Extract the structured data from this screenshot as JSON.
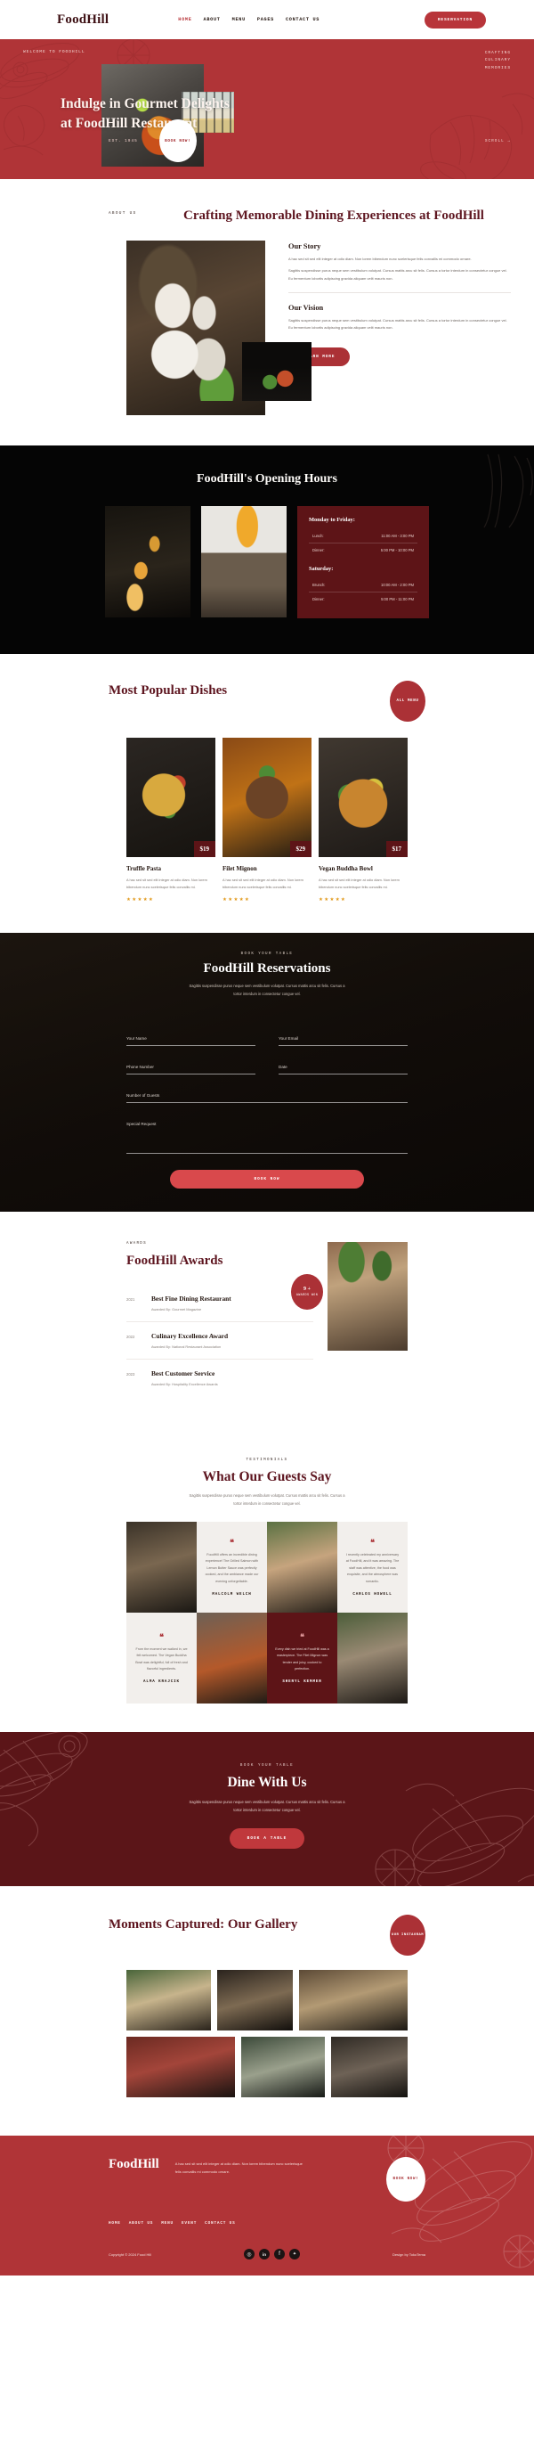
{
  "header": {
    "logo": "FoodHill",
    "nav": [
      {
        "label": "HOME",
        "active": true
      },
      {
        "label": "ABOUT",
        "active": false
      },
      {
        "label": "MENU",
        "active": false
      },
      {
        "label": "PAGES",
        "active": false
      },
      {
        "label": "CONTACT US",
        "active": false
      }
    ],
    "cta_label": "RESERVATION"
  },
  "hero": {
    "eyebrow_left": "WELCOME TO FOODHILL",
    "eyebrow_right": "CRAFTING CULINARY MEMORIES",
    "title": "Indulge in Gourmet Delights at FoodHill Restaurant",
    "est": "EST. 1945",
    "book_label": "BOOK NOW!",
    "scroll_label": "SCROLL →"
  },
  "about": {
    "eyebrow": "ABOUT US",
    "title": "Crafting Memorable Dining Experiences at FoodHill",
    "story_title": "Our Story",
    "story_p1": "A hac sed sit sed elit integer at odio diam. Non lorem bibendum nunc scelerisque felis convallis mi commodo ornare.",
    "story_p2": "Sagittis suspendisse purus neque sem vestibulum volutpat. Cursus mattis arcu sit felis. Cursus a tortor interdum in consectetur congue vel. Eu fermentum lobortis adipiscing gravida aliquam velit mauris non.",
    "vision_title": "Our Vision",
    "vision_p": "Sagittis suspendisse purus neque sem vestibulum volutpat. Cursus mattis arcu sit felis. Cursus a tortor interdum in consectetur congue vel. Eu fermentum lobortis adipiscing gravida aliquam velit mauris non.",
    "learn_label": "LEARN MORE"
  },
  "hours": {
    "title": "FoodHill's Opening Hours",
    "weekday_title": "Monday to Friday:",
    "weekday_rows": [
      {
        "label": "Lunch:",
        "time": "11:00 AM - 3:00 PM"
      },
      {
        "label": "Dinner:",
        "time": "5:00 PM - 10:00 PM"
      }
    ],
    "saturday_title": "Saturday:",
    "saturday_rows": [
      {
        "label": "Brunch:",
        "time": "10:00 AM - 2:00 PM"
      },
      {
        "label": "Dinner:",
        "time": "5:00 PM - 11:00 PM"
      }
    ]
  },
  "dishes": {
    "title": "Most Popular Dishes",
    "all_menu_label": "ALL MENU",
    "items": [
      {
        "name": "Truffle Pasta",
        "price": "$19",
        "desc": "A hac sed sit sed elit integer at odio diam. Non lorem bibendum nunc scelerisque felis convallis mi.",
        "stars": "★★★★★"
      },
      {
        "name": "Filet Mignon",
        "price": "$29",
        "desc": "A hac sed sit sed elit integer at odio diam. Non lorem bibendum nunc scelerisque felis convallis mi.",
        "stars": "★★★★★"
      },
      {
        "name": "Vegan Buddha Bowl",
        "price": "$17",
        "desc": "A hac sed sit sed elit integer at odio diam. Non lorem bibendum nunc scelerisque felis convallis mi.",
        "stars": "★★★★★"
      }
    ]
  },
  "reservations": {
    "eyebrow": "BOOK YOUR TABLE",
    "title": "FoodHill Reservations",
    "lede": "Sagittis suspendisse purus neque sem vestibulum volutpat. Cursus mattis arcu sit felis. Cursus a tortor interdum in consectetur congue vel.",
    "fields": {
      "name_placeholder": "Your Name",
      "email_placeholder": "Your Email",
      "phone_placeholder": "Phone Number",
      "date_placeholder": "Date",
      "guests_placeholder": "Number of Guests",
      "special_placeholder": "Special Request"
    },
    "submit_label": "BOOK NOW"
  },
  "awards": {
    "eyebrow": "AWARDS",
    "title": "FoodHill Awards",
    "badge_number": "9 +",
    "badge_label": "AWARDS WON",
    "items": [
      {
        "year": "2021",
        "title": "Best Fine Dining Restaurant",
        "by": "Awarded By: Gourmet Magazine"
      },
      {
        "year": "2022",
        "title": "Culinary Excellence Award",
        "by": "Awarded By: National Restaurant Association"
      },
      {
        "year": "2023",
        "title": "Best Customer Service",
        "by": "Awarded By: Hospitality Excellence Awards"
      }
    ]
  },
  "testimonials": {
    "eyebrow": "TESTIMONIALS",
    "title": "What Our Guests Say",
    "lede": "Sagittis suspendisse purus neque sem vestibulum volutpat. Cursus mattis arcu sit felis. Cursus a tortor interdum in consectetur congue vel.",
    "quote_mark": "❝",
    "items": [
      {
        "text": "FoodHill offers an incredible dining experience! The Grilled Salmon with Lemon Butter Sauce was perfectly cooked, and the ambiance made our evening unforgettable.",
        "name": "MALCOLM WELCH"
      },
      {
        "text": "I recently celebrated my anniversary at FoodHill, and it was amazing. The staff was attentive, the food was exquisite, and the atmosphere was romantic.",
        "name": "CARLOS HOWELL"
      },
      {
        "text": "From the moment we walked in, we felt welcomed. The Vegan Buddha Bowl was delightful, full of fresh and flavorful ingredients.",
        "name": "ALMA KRAJCIK"
      },
      {
        "text": "Every dish we tried at FoodHill was a masterpiece. The Filet Mignon was tender and juicy, cooked to perfection.",
        "name": "SHERYL KEMMER"
      }
    ]
  },
  "dine": {
    "eyebrow": "BOOK YOUR TABLE",
    "title": "Dine With Us",
    "lede": "Sagittis suspendisse purus neque sem vestibulum volutpat. Cursus mattis arcu sit felis. Cursus a tortor interdum in consectetur congue vel.",
    "cta_label": "BOOK A TABLE"
  },
  "gallery": {
    "title": "Moments Captured: Our Gallery",
    "instagram_label": "OUR INSTAGRAM"
  },
  "footer": {
    "logo": "FoodHill",
    "desc": "A hac sed sit sed elit integer at odio diam. Non lorem bibendum nunc scelerisque felis convallis mi commodo ornare.",
    "book_label": "BOOK NOW!",
    "nav": [
      "HOME",
      "ABOUT US",
      "MENU",
      "EVENT",
      "CONTACT US"
    ],
    "copyright": "Copyright © 2024 Food Hill",
    "design": "Design by TokoTema",
    "socials": [
      {
        "name": "instagram-icon",
        "glyph": "◎"
      },
      {
        "name": "linkedin-icon",
        "glyph": "in"
      },
      {
        "name": "facebook-icon",
        "glyph": "f"
      },
      {
        "name": "twitter-icon",
        "glyph": "✦"
      }
    ]
  },
  "colors": {
    "brand_red": "#b03437",
    "deep_maroon": "#5d1417",
    "title_maroon": "#5e1620",
    "accent_star": "#e29a1d"
  }
}
